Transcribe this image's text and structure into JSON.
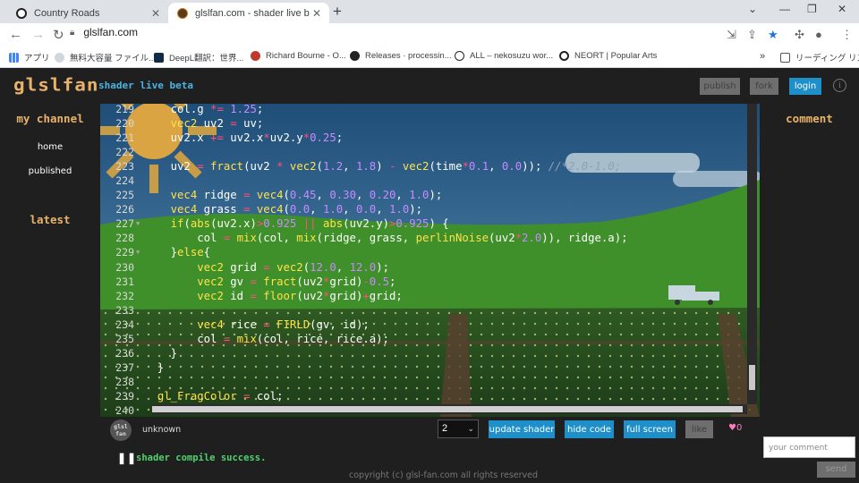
{
  "browser": {
    "tabs": [
      {
        "title": "Country Roads",
        "icon": "neort-icon"
      },
      {
        "title": "glslfan.com - shader live beta",
        "icon": "glslfan-icon"
      }
    ],
    "new_tab": "+",
    "close_glyph": "✕",
    "window_controls": {
      "minimize": "⌄",
      "restore": "—",
      "maximize": "❐",
      "close": "✕"
    },
    "url": "glslfan.com",
    "bookmarks": [
      {
        "label": "アプリ",
        "icon": "apps-grid-icon"
      },
      {
        "label": "無料大容量 ファイル...",
        "icon": "file-icon"
      },
      {
        "label": "DeepL翻訳：世界...",
        "icon": "deepl-icon"
      },
      {
        "label": "Richard Bourne - O...",
        "icon": "site-icon"
      },
      {
        "label": "Releases · processin...",
        "icon": "github-icon"
      },
      {
        "label": "ALL – nekosuzu wor...",
        "icon": "site-icon"
      },
      {
        "label": "NEORT | Popular Arts",
        "icon": "neort-icon"
      }
    ],
    "more": "»",
    "reading_list": "リーディング リスト"
  },
  "header": {
    "logo": "glslfan",
    "subtitle": "shader live beta",
    "publish": "publish",
    "fork": "fork",
    "login": "login",
    "info": "i"
  },
  "sidebar": {
    "my_channel": "my channel",
    "home": "home",
    "published": "published",
    "latest": "latest"
  },
  "comment": {
    "title": "comment",
    "placeholder": "your comment",
    "send": "send"
  },
  "editor": {
    "lines": [
      {
        "n": "219",
        "fold": "",
        "code": "    col.g *= 1.25;"
      },
      {
        "n": "220",
        "fold": "",
        "code": "    vec2 uv2 = uv;"
      },
      {
        "n": "221",
        "fold": "",
        "code": "    uv2.x += uv2.x*uv2.y*0.25;"
      },
      {
        "n": "222",
        "fold": "",
        "code": ""
      },
      {
        "n": "223",
        "fold": "",
        "code": "    uv2 = fract(uv2 * vec2(1.2, 1.8) - vec2(time*0.1, 0.0)); //*2.0-1.0;"
      },
      {
        "n": "224",
        "fold": "",
        "code": ""
      },
      {
        "n": "225",
        "fold": "",
        "code": "    vec4 ridge = vec4(0.45, 0.30, 0.20, 1.0);"
      },
      {
        "n": "226",
        "fold": "",
        "code": "    vec4 grass = vec4(0.0, 1.0, 0.0, 1.0);"
      },
      {
        "n": "227",
        "fold": "▼",
        "code": "    if(abs(uv2.x)>0.925 || abs(uv2.y)>0.925) {"
      },
      {
        "n": "228",
        "fold": "",
        "code": "        col = mix(col, mix(ridge, grass, perlinNoise(uv2*2.0)), ridge.a);"
      },
      {
        "n": "229",
        "fold": "▼",
        "code": "    }else{"
      },
      {
        "n": "230",
        "fold": "",
        "code": "        vec2 grid = vec2(12.0, 12.0);"
      },
      {
        "n": "231",
        "fold": "",
        "code": "        vec2 gv = fract(uv2*grid)-0.5;"
      },
      {
        "n": "232",
        "fold": "",
        "code": "        vec2 id = floor(uv2*grid)+grid;"
      },
      {
        "n": "233",
        "fold": "",
        "code": ""
      },
      {
        "n": "234",
        "fold": "",
        "code": "        vec4 rice = FIRLD(gv, id);"
      },
      {
        "n": "235",
        "fold": "",
        "code": "        col = mix(col, rice, rice.a);"
      },
      {
        "n": "236",
        "fold": "",
        "code": "    }"
      },
      {
        "n": "237",
        "fold": "",
        "code": "  }"
      },
      {
        "n": "238",
        "fold": "",
        "code": ""
      },
      {
        "n": "239",
        "fold": "",
        "code": "  gl_FragColor = col;"
      },
      {
        "n": "240",
        "fold": "",
        "code": ""
      }
    ]
  },
  "footer": {
    "avatar": "glsl fan",
    "user": "unknown",
    "select_value": "2",
    "update": "update shader",
    "hide": "hide code",
    "fullscreen": "full screen",
    "like": "like",
    "likes": "♥0",
    "pause": "❚❚",
    "status": "shader compile success.",
    "copyright": "copyright (c) glsl-fan.com all rights reserved"
  },
  "colors": {
    "logo": "#e9b26a",
    "accent": "#1e8fc8",
    "status": "#4fd36b",
    "keyword": "#ffe24a",
    "operator": "#ff4f7f",
    "number": "#c78aff"
  }
}
